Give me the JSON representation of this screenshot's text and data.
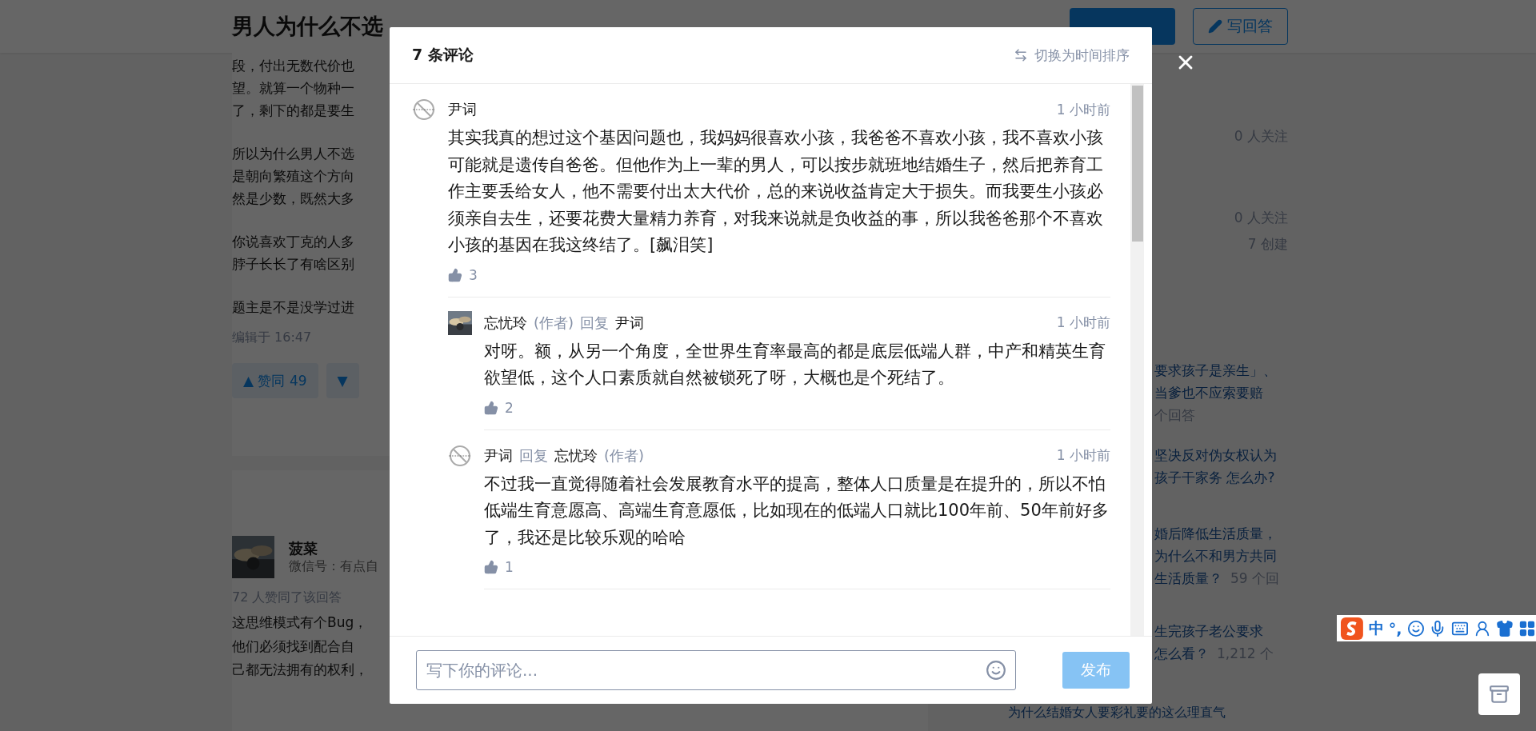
{
  "page": {
    "title": "男人为什么不选",
    "write_answer": "写回答",
    "answer": {
      "paragraphs": [
        [
          "段，付出无数代价也",
          "望。就算一个物种一",
          "了，剩下的都是要生"
        ],
        [
          "所以为什么男人不选",
          "是朝向繁殖这个方向",
          "然是少数，既然大多"
        ],
        [
          "你说喜欢丁克的人多",
          "脖子长长了有啥区别"
        ],
        [
          "题主是不是没学过进"
        ]
      ],
      "edited": "编辑于 16:47",
      "vote_up_arrow": "▲",
      "vote_up": "赞同 49",
      "vote_down": "▼"
    },
    "second_answer": {
      "author": "菠菜",
      "bio": "微信号：有点自",
      "votes": "72 人赞同了该回答",
      "lines": [
        "这思维模式有个Bug，",
        "他们必须找到配合自",
        "己都无法拥有的权利，"
      ]
    }
  },
  "sidebar": {
    "stats": [
      {
        "text": "0 人关注"
      },
      {
        "text": "0 人关注"
      },
      {
        "text": "7 创建"
      }
    ],
    "related": [
      {
        "kind": "clipped",
        "lines": [
          [
            {
              "kind": "title",
              "text": "要求孩子是亲生」、"
            }
          ],
          [
            {
              "kind": "title",
              "text": "当爹也不应索要赔"
            }
          ],
          [
            {
              "kind": "count",
              "text": "个回答"
            }
          ]
        ]
      },
      {
        "kind": "clipped",
        "lines": [
          [
            {
              "kind": "title",
              "text": "坚决反对伪女权认为"
            }
          ],
          [
            {
              "kind": "title",
              "text": "孩子干家务 怎么办?"
            }
          ]
        ]
      },
      {
        "kind": "clipped",
        "lines": [
          [
            {
              "kind": "title",
              "text": "婚后降低生活质量，"
            }
          ],
          [
            {
              "kind": "title",
              "text": "为什么不和男方共同"
            }
          ],
          [
            {
              "kind": "title",
              "text": "生活质量？"
            },
            {
              "kind": "count",
              "text": "59 个回"
            }
          ]
        ]
      },
      {
        "kind": "clipped",
        "lines": [
          [
            {
              "kind": "title",
              "text": "生完孩子老公要求"
            }
          ],
          [
            {
              "kind": "title",
              "text": "怎么看？"
            },
            {
              "kind": "count",
              "text": "1,212 个"
            }
          ]
        ]
      },
      {
        "kind": "full",
        "lines": [
          [
            {
              "kind": "title",
              "text": "为什么结婚女人要彩礼要的这么理直气"
            }
          ]
        ]
      }
    ]
  },
  "modal": {
    "title": "7 条评论",
    "sort_toggle": "切换为时间排序",
    "comments": [
      {
        "kind": "blank",
        "author": "尹词",
        "time": "1 小时前",
        "text": "其实我真的想过这个基因问题也，我妈妈很喜欢小孩，我爸爸不喜欢小孩，我不喜欢小孩可能就是遗传自爸爸。但他作为上一辈的男人，可以按步就班地结婚生子，然后把养育工作主要丢给女人，他不需要付出太大代价，总的来说收益肯定大于损失。而我要生小孩必须亲自去生，还要花费大量精力养育，对我来说就是负收益的事，所以我爸爸那个不喜欢小孩的基因在我这终结了。[飙泪笑]",
        "likes": "3",
        "children": [
          {
            "author": "忘忧玲",
            "author_tag": "(作者)",
            "reply_word": "回复",
            "reply_to": "尹词",
            "time": "1 小时前",
            "text": "对呀。额，从另一个角度，全世界生育率最高的都是底层低端人群，中产和精英生育欲望低，这个人口素质就自然被锁死了呀，大概也是个死结了。",
            "likes": "2"
          },
          {
            "kind": "blank",
            "author": "尹词",
            "reply_word": "回复",
            "reply_to": "忘忧玲",
            "reply_to_tag": "(作者)",
            "time": "1 小时前",
            "text": "不过我一直觉得随着社会发展教育水平的提高，整体人口质量是在提升的，所以不怕低端生育意愿高、高端生育意愿低，比如现在的低端人口就比100年前、50年前好多了，我还是比较乐观的哈哈",
            "likes": "1"
          }
        ]
      }
    ],
    "input": {
      "placeholder": "写下你的评论..."
    },
    "submit": {
      "label": "发布",
      "disabled": true
    }
  },
  "ime": {
    "items": [
      "中",
      "°,"
    ]
  }
}
